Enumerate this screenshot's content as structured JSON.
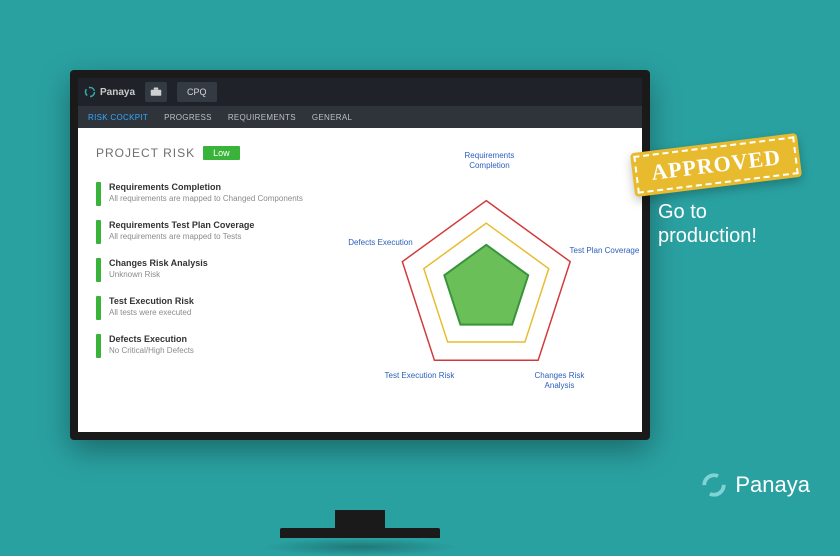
{
  "brand": "Panaya",
  "topbar": {
    "suitcase_icon": "suitcase",
    "tab_label": "CPQ"
  },
  "nav": {
    "items": [
      {
        "label": "RISK COCKPIT",
        "active": true
      },
      {
        "label": "PROGRESS",
        "active": false
      },
      {
        "label": "REQUIREMENTS",
        "active": false
      },
      {
        "label": "GENERAL",
        "active": false
      }
    ]
  },
  "project_risk": {
    "title": "PROJECT RISK",
    "badge": "Low",
    "badge_color": "#39b339"
  },
  "risk_items": [
    {
      "title": "Requirements Completion",
      "desc": "All requirements are mapped to Changed Components"
    },
    {
      "title": "Requirements Test Plan Coverage",
      "desc": "All requirements are mapped to Tests"
    },
    {
      "title": "Changes Risk Analysis",
      "desc": "Unknown Risk"
    },
    {
      "title": "Test Execution Risk",
      "desc": "All tests were executed"
    },
    {
      "title": "Defects Execution",
      "desc": "No Critical/High Defects"
    }
  ],
  "radar_labels": {
    "top": "Requirements Completion",
    "right": "Test Plan Coverage",
    "bottom_right": "Changes Risk Analysis",
    "bottom_left": "Test Execution Risk",
    "left": "Defects Execution"
  },
  "stamp_text": "APPROVED",
  "go_text": "Go to production!",
  "chart_data": {
    "type": "radar",
    "axes": [
      "Requirements Completion",
      "Test Plan Coverage",
      "Changes Risk Analysis",
      "Test Execution Risk",
      "Defects Execution"
    ],
    "rings": [
      {
        "name": "outer",
        "color": "#d23a3a",
        "radius": 1.0
      },
      {
        "name": "middle",
        "color": "#e8bb2e",
        "radius": 0.75
      },
      {
        "name": "inner",
        "color": "#39b339",
        "radius": 0.5,
        "fill": "#6bbf59"
      }
    ],
    "note": "All five axes show the project in the green (low-risk) inner ring."
  }
}
